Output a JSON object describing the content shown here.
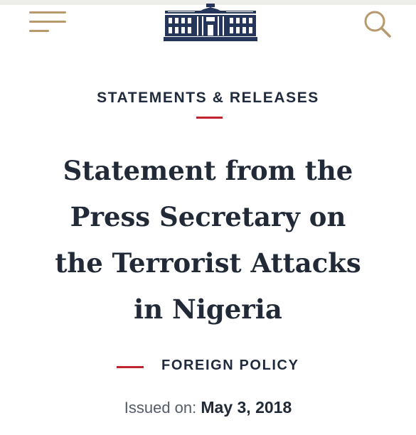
{
  "header": {
    "menu_icon": "hamburger-menu-icon",
    "logo_icon": "white-house-logo-icon",
    "search_icon": "search-icon",
    "accent_color": "#b69a6e",
    "logo_color": "#26365a"
  },
  "article": {
    "section": "STATEMENTS & RELEASES",
    "title_lines": [
      "Statement from the",
      "Press Secretary on",
      "the Terrorist Attacks",
      "in Nigeria"
    ],
    "category": "FOREIGN POLICY",
    "issued_label": "Issued on:",
    "issued_date": "May 3, 2018",
    "rule_color": "#c0252f"
  }
}
